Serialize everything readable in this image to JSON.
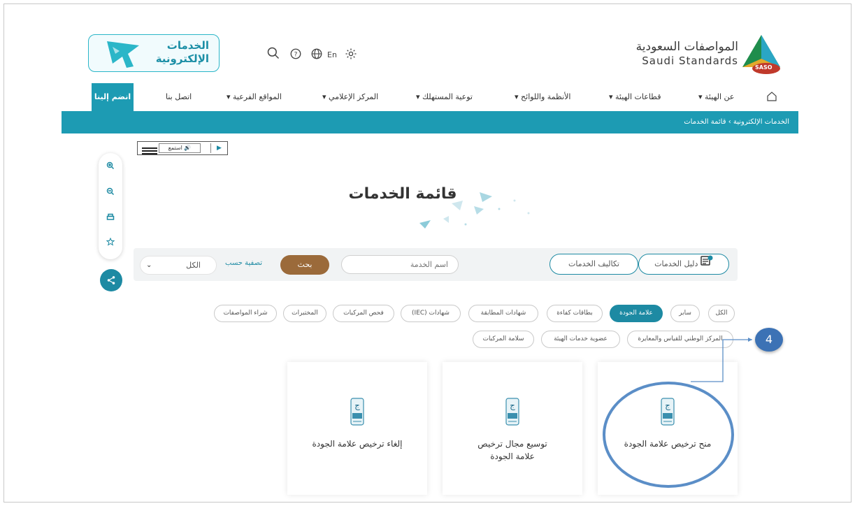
{
  "header": {
    "logo_ar": "المواصفات السعودية",
    "logo_en": "Saudi Standards",
    "logo_badge": "SASO",
    "eservices_line1": "الخدمات",
    "eservices_line2": "الإلكترونية",
    "lang": "En",
    "icons": [
      "search-icon",
      "help-icon",
      "globe-icon",
      "gear-icon"
    ]
  },
  "nav": {
    "home_icon": "home-icon",
    "items": [
      {
        "label": "عن الهيئة"
      },
      {
        "label": "قطاعات الهيئة"
      },
      {
        "label": "الأنظمة واللوائح"
      },
      {
        "label": "توعية المستهلك"
      },
      {
        "label": "المركز الإعلامي"
      },
      {
        "label": "المواقع الفرعية"
      },
      {
        "label": "اتصل بنا"
      }
    ],
    "join": "انضم إلينا"
  },
  "breadcrumb": {
    "parent": "الخدمات الإلكترونية",
    "current": "قائمة الخدمات"
  },
  "player": {
    "listen": "استمع"
  },
  "page_title": "قائمة الخدمات",
  "toolbar": {
    "guide": "دليل الخدمات",
    "costs": "تكاليف الخدمات",
    "search_placeholder": "اسم الخدمة",
    "search_button": "بحث",
    "filter_label": "تصفية حسب",
    "filter_value": "الكل"
  },
  "categories": {
    "row1": [
      "الكل",
      "سابر",
      "علامة الجودة",
      "بطاقات كفاءة",
      "شهادات المطابقة",
      "شهادات (IEC)",
      "فحص المركبات",
      "المختبرات",
      "شراء المواصفات"
    ],
    "row2": [
      "المركز الوطني للقياس والمعايرة",
      "عضوية خدمات الهيئة",
      "سلامة المركبات"
    ],
    "active": "علامة الجودة"
  },
  "cards": [
    {
      "title": "منح ترخيص علامة الجودة"
    },
    {
      "title": "توسيع مجال ترخيص علامة الجودة"
    },
    {
      "title": "إلغاء ترخيص علامة الجودة"
    }
  ],
  "annotation": {
    "step": "4",
    "color": "#3c72b5"
  },
  "colors": {
    "teal": "#1d9bb3",
    "brown": "#9b6a3a"
  }
}
